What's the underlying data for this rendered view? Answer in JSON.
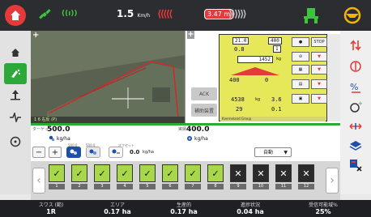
{
  "topbar": {
    "signal_text": "((ı))",
    "speed_value": "1.5",
    "speed_unit": "Km/h",
    "chevrons_left": "⟨⟨⟨⟨⟨",
    "offset": "3.47 m",
    "chevrons_right": "⟩⟩⟩⟩⟩⟩"
  },
  "map": {
    "status": "1 6 右反 (P)"
  },
  "spreader": {
    "ack_label": "ACK",
    "assist_label": "補助装置",
    "terminal": {
      "width_a": "21.0",
      "width_b": "400",
      "speed_small": "0.8",
      "count_small": "1",
      "rate_main": "1452",
      "rate_unit": "kg",
      "rate_left": "400",
      "rate_right": "0",
      "weight_total": "4538",
      "weight_unit": "kg",
      "time_val": "3.6",
      "area_val": "29",
      "area_right": "0.1",
      "stop_label": "STOP",
      "footer": "Kverneland Group"
    }
  },
  "rates": {
    "target_label": "ターゲット",
    "target_value": "500.0",
    "target_unit": "kg/ha",
    "actual_label": "実績",
    "actual_value": "400.0",
    "actual_unit": "kg/ha"
  },
  "controls": {
    "minus": "−",
    "plus": "+",
    "label_a": "500.0",
    "label_b": "500.0",
    "offset_label": "オフセット",
    "offset_value": "0.0",
    "offset_unit": "kg/ha",
    "mode": "自動"
  },
  "sections": [
    {
      "num": "1",
      "state": "on",
      "mark": "✓"
    },
    {
      "num": "2",
      "state": "on",
      "mark": "✓"
    },
    {
      "num": "3",
      "state": "on",
      "mark": "✓"
    },
    {
      "num": "4",
      "state": "on",
      "mark": "✓"
    },
    {
      "num": "5",
      "state": "on",
      "mark": "✓"
    },
    {
      "num": "6",
      "state": "on",
      "mark": "✓"
    },
    {
      "num": "7",
      "state": "on",
      "mark": "✓"
    },
    {
      "num": "8",
      "state": "on",
      "mark": "✓"
    },
    {
      "num": "9",
      "state": "off",
      "mark": "✕"
    },
    {
      "num": "10",
      "state": "off",
      "mark": "✕"
    },
    {
      "num": "11",
      "state": "off",
      "mark": "✕"
    },
    {
      "num": "12",
      "state": "off",
      "mark": "✕"
    }
  ],
  "stats": [
    {
      "label": "スワス (範)",
      "value": "1R"
    },
    {
      "label": "エリア",
      "value": "0.17 ha"
    },
    {
      "label": "生産的",
      "value": "0.17 ha"
    },
    {
      "label": "進捗状況",
      "value": "0.04 ha"
    },
    {
      "label": "受信可能域%",
      "value": "25%"
    }
  ],
  "colors": {
    "accent_green": "#2ea839",
    "alert_red": "#e43a3a",
    "topbar": "#2b2d31"
  }
}
